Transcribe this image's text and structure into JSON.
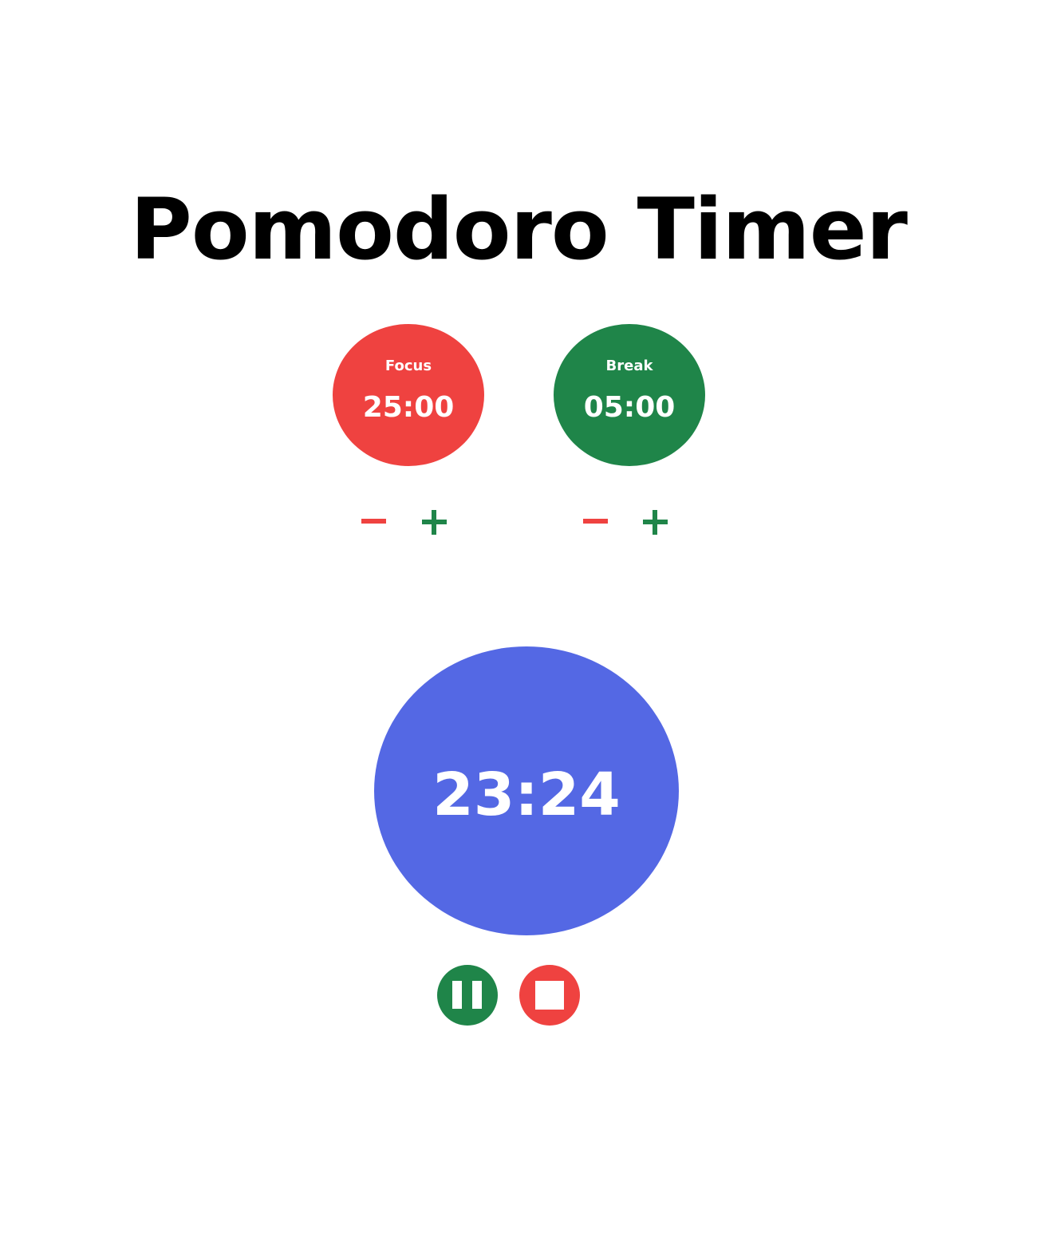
{
  "title": "Pomodoro Timer",
  "focus": {
    "label": "Focus",
    "value": "25:00",
    "color": "#ef4240"
  },
  "break": {
    "label": "Break",
    "value": "05:00",
    "color": "#1f8549"
  },
  "adjust": {
    "minus_color": "#ef4240",
    "plus_color": "#1f8549",
    "minus_icon": "minus-icon",
    "plus_icon": "plus-icon"
  },
  "timer": {
    "value": "23:24",
    "color": "#5468e4"
  },
  "controls": {
    "pause_color": "#1f8549",
    "stop_color": "#ef4240",
    "pause_icon": "pause-icon",
    "stop_icon": "stop-icon"
  }
}
